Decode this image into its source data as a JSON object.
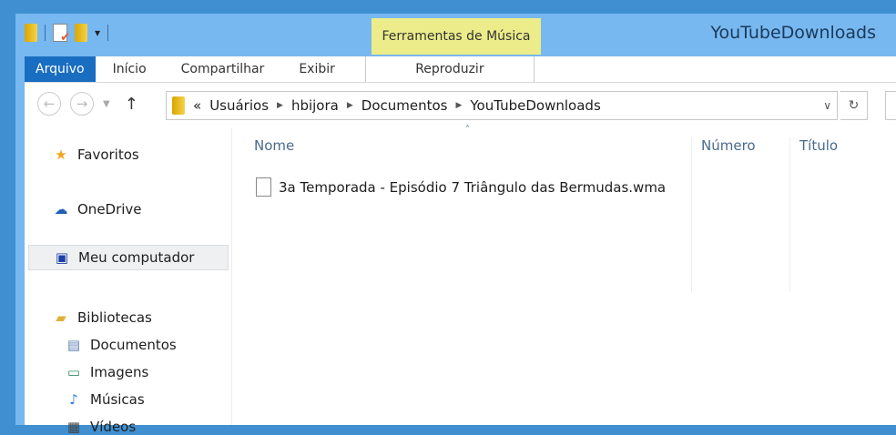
{
  "window": {
    "title": "YouTubeDownloads",
    "context_group": "Ferramentas de Música"
  },
  "ribbon": {
    "tabs": [
      "Arquivo",
      "Início",
      "Compartilhar",
      "Exibir",
      "Reproduzir"
    ]
  },
  "address": {
    "overflow": "«",
    "crumbs": [
      "Usuários",
      "hbijora",
      "Documentos",
      "YouTubeDownloads"
    ]
  },
  "sidebar": {
    "items": [
      {
        "label": "Favoritos",
        "icon": "star-icon"
      },
      {
        "label": "OneDrive",
        "icon": "cloud-icon"
      },
      {
        "label": "Meu computador",
        "icon": "computer-icon"
      },
      {
        "label": "Bibliotecas",
        "icon": "library-icon"
      },
      {
        "label": "Documentos",
        "icon": "document-icon"
      },
      {
        "label": "Imagens",
        "icon": "image-icon"
      },
      {
        "label": "Músicas",
        "icon": "music-icon"
      },
      {
        "label": "Vídeos",
        "icon": "video-icon"
      }
    ]
  },
  "columns": [
    "Nome",
    "Número",
    "Título"
  ],
  "files": [
    {
      "name": "3a Temporada - Episódio 7 Triângulo das Bermudas.wma"
    }
  ]
}
